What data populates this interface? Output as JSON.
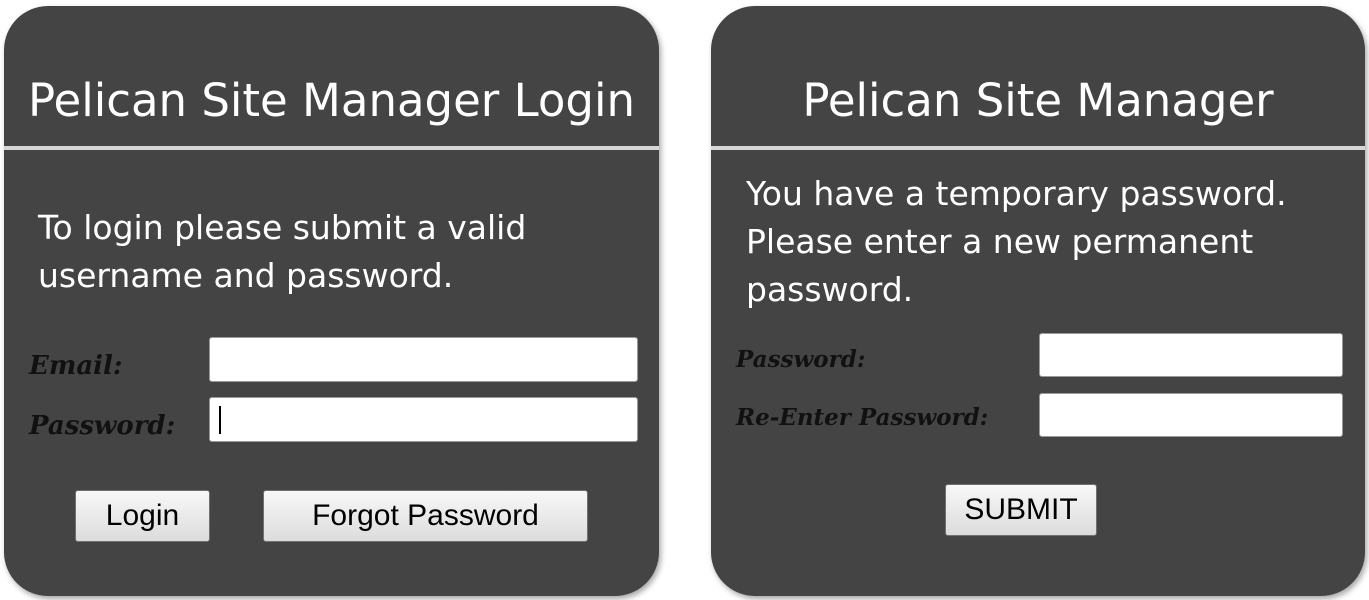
{
  "login_panel": {
    "title": "Pelican Site Manager Login",
    "message": "To login please submit a valid username and password.",
    "email_label": "Email:",
    "email_value": "",
    "password_label": "Password:",
    "password_value": "",
    "login_button": "Login",
    "forgot_button": "Forgot Password"
  },
  "reset_panel": {
    "title": "Pelican Site Manager",
    "message": "You have a temporary password. Please enter a new permanent password.",
    "password_label": "Password:",
    "password_value": "",
    "reenter_label": "Re-Enter Password:",
    "reenter_value": "",
    "submit_button": "SUBMIT"
  },
  "colors": {
    "panel_background": "#444444",
    "divider": "#d6d6d6",
    "label_text": "#111111"
  }
}
